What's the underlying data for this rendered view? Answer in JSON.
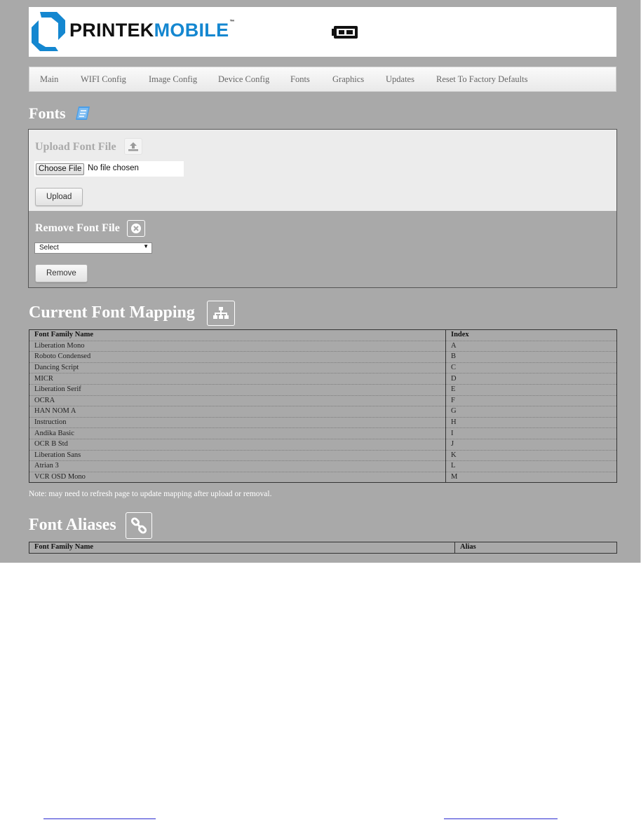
{
  "brand": {
    "logo_part1": "PRINTEK",
    "logo_part2": "MOBILE",
    "trademark": "™",
    "battery_icon": "battery-icon",
    "accent_color": "#1487d0"
  },
  "nav": {
    "items": [
      "Main",
      "WIFI Config",
      "Image Config",
      "Device Config",
      "Fonts",
      "Graphics",
      "Updates",
      "Reset To Factory Defaults"
    ]
  },
  "fonts_section": {
    "title": "Fonts",
    "title_icon": "book-icon",
    "upload": {
      "title": "Upload Font File",
      "icon": "upload-icon",
      "choose_label": "Choose File",
      "no_file_text": "No file chosen",
      "button_label": "Upload"
    },
    "remove": {
      "title": "Remove Font File",
      "icon": "remove-circle-icon",
      "select_value": "Select",
      "button_label": "Remove"
    }
  },
  "mapping": {
    "title": "Current Font Mapping",
    "icon": "sitemap-icon",
    "headers": [
      "Font Family Name",
      "Index"
    ],
    "rows": [
      [
        "Liberation Mono",
        "A"
      ],
      [
        "Roboto Condensed",
        "B"
      ],
      [
        "Dancing Script",
        "C"
      ],
      [
        "MICR",
        "D"
      ],
      [
        "Liberation Serif",
        "E"
      ],
      [
        "OCRA",
        "F"
      ],
      [
        "HAN NOM A",
        "G"
      ],
      [
        "Instruction",
        "H"
      ],
      [
        "Andika Basic",
        "I"
      ],
      [
        "OCR B Std",
        "J"
      ],
      [
        "Liberation Sans",
        "K"
      ],
      [
        "Atrian 3",
        "L"
      ],
      [
        "VCR OSD Mono",
        "M"
      ]
    ],
    "note": "Note: may need to refresh page to update mapping after upload or removal."
  },
  "aliases": {
    "title": "Font Aliases",
    "icon": "link-icon",
    "headers": [
      "Font Family Name",
      "Alias"
    ]
  }
}
